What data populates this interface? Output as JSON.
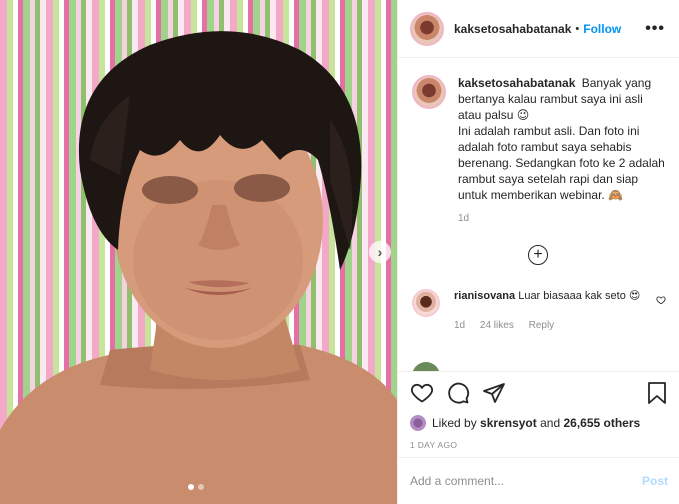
{
  "post": {
    "username": "kaksetosahabatanak",
    "separator": "•",
    "follow_label": "Follow",
    "more_label": "•••"
  },
  "caption": {
    "username": "kaksetosahabatanak",
    "text": "Banyak yang bertanya kalau rambut saya ini asli atau palsu 😉",
    "text2": "Ini adalah rambut asli. Dan foto ini adalah foto rambut saya sehabis berenang. Sedangkan foto ke 2 adalah rambut saya setelah rapi dan siap untuk memberikan webinar. 🙈",
    "time": "1d"
  },
  "load_more_label": "+",
  "comment": {
    "username": "rianisovana",
    "text": "Luar biasaaa kak seto 😍",
    "time": "1d",
    "likes": "24 likes",
    "reply_label": "Reply"
  },
  "partial_comment": {
    "text": "…"
  },
  "likes": {
    "prefix": "Liked by",
    "user": "skrensyot",
    "middle": "and",
    "count": "26,655 others"
  },
  "timestamp": "1 DAY AGO",
  "add_comment": {
    "placeholder": "Add a comment...",
    "post_label": "Post"
  },
  "carousel": {
    "next_label": "›",
    "slide_count": 2,
    "current": 1
  },
  "icons": [
    "heart-icon",
    "comment-icon",
    "share-icon",
    "bookmark-icon",
    "more-icon",
    "plus-circle-icon",
    "chevron-right-icon"
  ],
  "colors": {
    "accent": "#0095f6",
    "post_disabled": "#b3dbff",
    "muted": "#8e8e8e",
    "text": "#262626"
  }
}
